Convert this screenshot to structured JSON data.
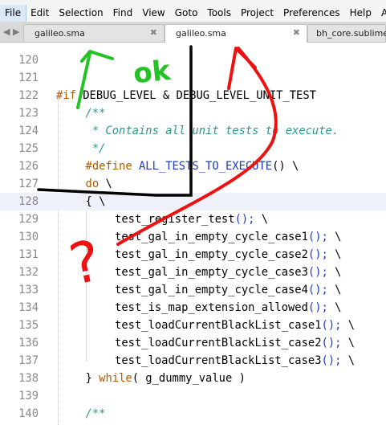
{
  "menu": [
    "File",
    "Edit",
    "Selection",
    "Find",
    "View",
    "Goto",
    "Tools",
    "Project",
    "Preferences",
    "Help",
    "Amx"
  ],
  "tabs": [
    {
      "label": "galileo.sma",
      "close": "✖",
      "selected": false
    },
    {
      "label": "galileo.sma",
      "close": "✖",
      "selected": true
    },
    {
      "label": "bh_core.sublime-",
      "close": "",
      "selected": false
    }
  ],
  "nav_arrows": {
    "left": "◀",
    "right": "▶"
  },
  "annotation": {
    "ok_text": "ok",
    "question_text": "?"
  },
  "colors": {
    "keyword": "#b35a00",
    "function": "#1d3ac9",
    "comment": "#2b9a8c",
    "highlight": "#eef0fa",
    "annotation_green": "#22c322",
    "annotation_red": "#ee1111",
    "annotation_black": "#000000"
  },
  "lines": [
    {
      "num": "120",
      "indent": 0,
      "hl": false,
      "parts": []
    },
    {
      "num": "121",
      "indent": 0,
      "hl": false,
      "parts": []
    },
    {
      "num": "122",
      "indent": 0,
      "hl": false,
      "parts": [
        {
          "t": "#if ",
          "c": "kw"
        },
        {
          "t": "DEBUG_LEVEL & DEBUG_LEVEL_UNIT_TEST",
          "c": ""
        }
      ]
    },
    {
      "num": "123",
      "indent": 1,
      "hl": false,
      "parts": [
        {
          "t": "/**",
          "c": "cm"
        }
      ]
    },
    {
      "num": "124",
      "indent": 1,
      "hl": false,
      "parts": [
        {
          "t": " * Contains all unit tests to execute.",
          "c": "cm"
        }
      ]
    },
    {
      "num": "125",
      "indent": 1,
      "hl": false,
      "parts": [
        {
          "t": " */",
          "c": "cm"
        }
      ]
    },
    {
      "num": "126",
      "indent": 1,
      "hl": false,
      "parts": [
        {
          "t": "#define ",
          "c": "kw"
        },
        {
          "t": "ALL_TESTS_TO_EXECUTE",
          "c": "fn"
        },
        {
          "t": "() \\",
          "c": ""
        }
      ]
    },
    {
      "num": "127",
      "indent": 1,
      "hl": false,
      "parts": [
        {
          "t": "do",
          "c": "kw"
        },
        {
          "t": " \\",
          "c": ""
        }
      ]
    },
    {
      "num": "128",
      "indent": 1,
      "hl": true,
      "parts": [
        {
          "t": "{ \\",
          "c": ""
        }
      ]
    },
    {
      "num": "129",
      "indent": 2,
      "hl": false,
      "parts": [
        {
          "t": "test_register_test",
          "c": ""
        },
        {
          "t": "();",
          "c": "nb"
        },
        {
          "t": " \\",
          "c": ""
        }
      ]
    },
    {
      "num": "130",
      "indent": 2,
      "hl": false,
      "parts": [
        {
          "t": "test_gal_in_empty_cycle_case1",
          "c": ""
        },
        {
          "t": "();",
          "c": "nb"
        },
        {
          "t": " \\",
          "c": ""
        }
      ]
    },
    {
      "num": "131",
      "indent": 2,
      "hl": false,
      "parts": [
        {
          "t": "test_gal_in_empty_cycle_case2",
          "c": ""
        },
        {
          "t": "();",
          "c": "nb"
        },
        {
          "t": " \\",
          "c": ""
        }
      ]
    },
    {
      "num": "132",
      "indent": 2,
      "hl": false,
      "parts": [
        {
          "t": "test_gal_in_empty_cycle_case3",
          "c": ""
        },
        {
          "t": "();",
          "c": "nb"
        },
        {
          "t": " \\",
          "c": ""
        }
      ]
    },
    {
      "num": "133",
      "indent": 2,
      "hl": false,
      "parts": [
        {
          "t": "test_gal_in_empty_cycle_case4",
          "c": ""
        },
        {
          "t": "();",
          "c": "nb"
        },
        {
          "t": " \\",
          "c": ""
        }
      ]
    },
    {
      "num": "134",
      "indent": 2,
      "hl": false,
      "parts": [
        {
          "t": "test_is_map_extension_allowed",
          "c": ""
        },
        {
          "t": "();",
          "c": "nb"
        },
        {
          "t": " \\",
          "c": ""
        }
      ]
    },
    {
      "num": "135",
      "indent": 2,
      "hl": false,
      "parts": [
        {
          "t": "test_loadCurrentBlackList_case1",
          "c": ""
        },
        {
          "t": "();",
          "c": "nb"
        },
        {
          "t": " \\",
          "c": ""
        }
      ]
    },
    {
      "num": "136",
      "indent": 2,
      "hl": false,
      "parts": [
        {
          "t": "test_loadCurrentBlackList_case2",
          "c": ""
        },
        {
          "t": "();",
          "c": "nb"
        },
        {
          "t": " \\",
          "c": ""
        }
      ]
    },
    {
      "num": "137",
      "indent": 2,
      "hl": false,
      "parts": [
        {
          "t": "test_loadCurrentBlackList_case3",
          "c": ""
        },
        {
          "t": "();",
          "c": "nb"
        },
        {
          "t": " \\",
          "c": ""
        }
      ]
    },
    {
      "num": "138",
      "indent": 1,
      "hl": false,
      "parts": [
        {
          "t": "} ",
          "c": ""
        },
        {
          "t": "while",
          "c": "kw"
        },
        {
          "t": "( g_dummy_value )",
          "c": ""
        }
      ]
    },
    {
      "num": "139",
      "indent": 0,
      "hl": false,
      "parts": []
    },
    {
      "num": "140",
      "indent": 1,
      "hl": false,
      "parts": [
        {
          "t": "/**",
          "c": "cm"
        }
      ]
    }
  ]
}
